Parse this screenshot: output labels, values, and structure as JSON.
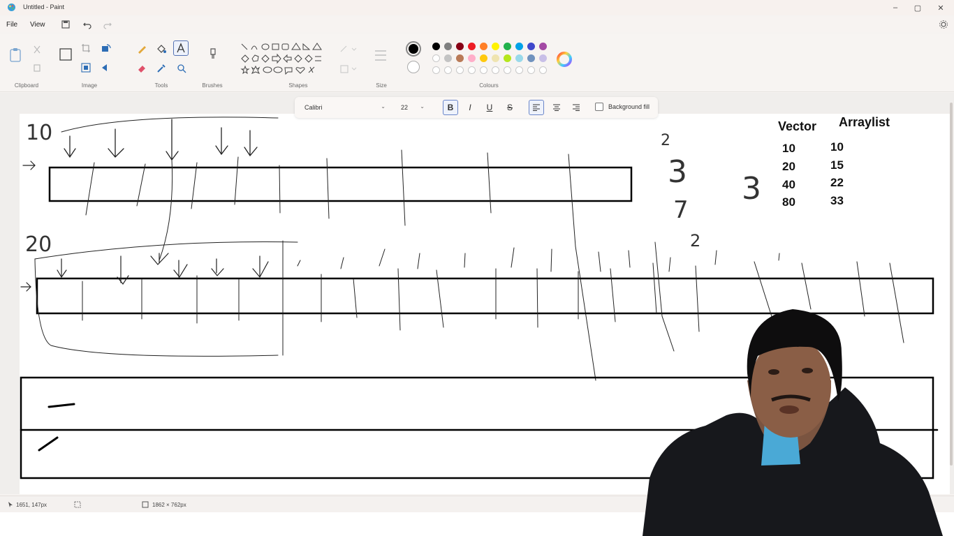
{
  "window": {
    "title": "Untitled - Paint",
    "minimize": "–",
    "maximize": "▢",
    "close": "✕"
  },
  "menu": {
    "file": "File",
    "view": "View"
  },
  "ribbon": {
    "groups": {
      "clipboard": "Clipboard",
      "image": "Image",
      "tools": "Tools",
      "brushes": "Brushes",
      "shapes": "Shapes",
      "size": "Size",
      "colours": "Colours"
    },
    "palette_row1": [
      "#000000",
      "#7f7f7f",
      "#880015",
      "#ed1c24",
      "#ff7f27",
      "#fff200",
      "#22b14c",
      "#00a2e8",
      "#3f48cc",
      "#a349a4"
    ],
    "palette_row2": [
      "#ffffff",
      "#c3c3c3",
      "#b97a57",
      "#ffaec9",
      "#ffc90e",
      "#efe4b0",
      "#b5e61d",
      "#99d9ea",
      "#7092be",
      "#c8bfe7"
    ],
    "primary_color": "#000000",
    "secondary_color": "#ffffff"
  },
  "text_toolbar": {
    "font": "Calibri",
    "size": "22",
    "bold": "B",
    "italic": "I",
    "underline": "U",
    "strike": "S",
    "background_fill": "Background fill"
  },
  "canvas": {
    "annotations": {
      "num_10": "10",
      "num_20": "20",
      "num_2a": "2",
      "num_3a": "3",
      "num_7": "7",
      "num_2b": "2",
      "num_3b": "3"
    },
    "table": {
      "headers": [
        "Vector",
        "Arraylist"
      ],
      "vector": [
        "10",
        "20",
        "40",
        "80"
      ],
      "arraylist": [
        "10",
        "15",
        "22",
        "33"
      ]
    }
  },
  "status": {
    "cursor_pos": "1651, 147px",
    "canvas_size": "1862 × 762px"
  }
}
